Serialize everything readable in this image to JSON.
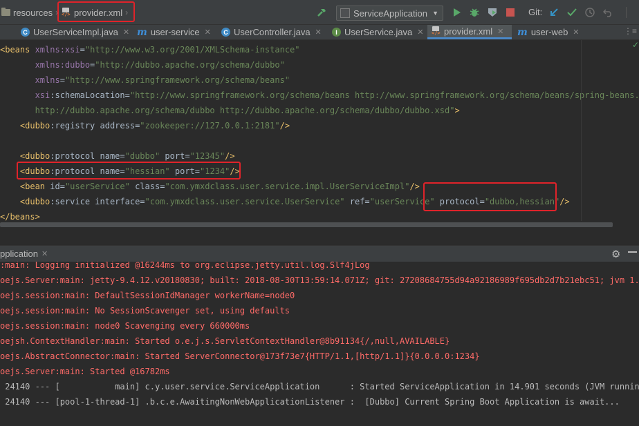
{
  "navbar": {
    "breadcrumbs": [
      {
        "label": "resources",
        "icon": "folder-icon"
      },
      {
        "label": "provider.xml",
        "icon": "xml-file-icon"
      }
    ],
    "run_config": "ServiceApplication",
    "vcs_label": "Git:",
    "icons": [
      "build-hammer-icon",
      "run-icon",
      "debug-icon",
      "coverage-icon",
      "stop-icon",
      "vcs-update-icon",
      "vcs-commit-icon",
      "vcs-history-icon",
      "vcs-revert-icon"
    ]
  },
  "tabs": [
    {
      "label": "UserServiceImpl.java",
      "icon": "class-icon",
      "icon_letter": "C"
    },
    {
      "label": "user-service",
      "icon": "maven-module-icon",
      "icon_letter": "m"
    },
    {
      "label": "UserController.java",
      "icon": "class-icon",
      "icon_letter": "C"
    },
    {
      "label": "UserService.java",
      "icon": "interface-icon",
      "icon_letter": "I"
    },
    {
      "label": "provider.xml",
      "icon": "xml-file-icon",
      "active": true
    },
    {
      "label": "user-web",
      "icon": "maven-module-icon",
      "icon_letter": "m"
    }
  ],
  "editor": {
    "lines": [
      [
        [
          "tag",
          "<beans "
        ],
        [
          "ns",
          "xmlns:xsi"
        ],
        [
          "plain",
          "="
        ],
        [
          "val",
          "\"http://www.w3.org/2001/XMLSchema-instance\""
        ]
      ],
      [
        [
          "ns",
          "       xmlns:dubbo"
        ],
        [
          "plain",
          "="
        ],
        [
          "val",
          "\"http://dubbo.apache.org/schema/dubbo\""
        ]
      ],
      [
        [
          "ns",
          "       xmlns"
        ],
        [
          "plain",
          "="
        ],
        [
          "val",
          "\"http://www.springframework.org/schema/beans\""
        ]
      ],
      [
        [
          "ns",
          "       xsi"
        ],
        [
          "plain",
          ":schemaLocation="
        ],
        [
          "val",
          "\"http://www.springframework.org/schema/beans http://www.springframework.org/schema/beans/spring-beans.xsd"
        ]
      ],
      [
        [
          "val",
          "       http://dubbo.apache.org/schema/dubbo http://dubbo.apache.org/schema/dubbo/dubbo.xsd\""
        ],
        [
          "tag",
          ">"
        ]
      ],
      [
        [
          "tag",
          "    <dubbo"
        ],
        [
          "plain",
          ":registry address="
        ],
        [
          "val",
          "\"zookeeper://127.0.0.1:2181\""
        ],
        [
          "tag",
          "/>"
        ]
      ],
      [],
      [
        [
          "tag",
          "    <dubbo"
        ],
        [
          "plain",
          ":protocol name="
        ],
        [
          "val",
          "\"dubbo\""
        ],
        [
          "plain",
          " port="
        ],
        [
          "val",
          "\"12345\""
        ],
        [
          "tag",
          "/>"
        ]
      ],
      [
        [
          "tag",
          "    <dubbo"
        ],
        [
          "plain",
          ":protocol name="
        ],
        [
          "val",
          "\"hessian\""
        ],
        [
          "plain",
          " port="
        ],
        [
          "val",
          "\"1234\""
        ],
        [
          "tag",
          "/>"
        ]
      ],
      [
        [
          "tag",
          "    <bean "
        ],
        [
          "plain",
          "id="
        ],
        [
          "val",
          "\"userService\""
        ],
        [
          "plain",
          " class="
        ],
        [
          "val",
          "\"com.ymxdclass.user.service.impl.UserServiceImpl\""
        ],
        [
          "tag",
          "/>"
        ]
      ],
      [
        [
          "tag",
          "    <dubbo"
        ],
        [
          "plain",
          ":service interface="
        ],
        [
          "val",
          "\"com.ymxdclass.user.service.UserService\""
        ],
        [
          "plain",
          " ref="
        ],
        [
          "val",
          "\"userService\""
        ],
        [
          "plain",
          " protocol="
        ],
        [
          "val",
          "\"dubbo,hessian\""
        ],
        [
          "tag",
          "/>"
        ]
      ],
      [
        [
          "tag",
          "</beans>"
        ]
      ]
    ]
  },
  "run_panel": {
    "title": "pplication",
    "settings_icon": "gear-icon",
    "log_lines": [
      {
        "color": "red",
        "text": ":main: Logging initialized @16244ms to org.eclipse.jetty.util.log.Slf4jLog"
      },
      {
        "color": "red",
        "text": "oejs.Server:main: jetty-9.4.12.v20180830; built: 2018-08-30T13:59:14.071Z; git: 27208684755d94a92186989f695db2d7b21ebc51; jvm 1.8.0_"
      },
      {
        "color": "red",
        "text": "oejs.session:main: DefaultSessionIdManager workerName=node0"
      },
      {
        "color": "red",
        "text": "oejs.session:main: No SessionScavenger set, using defaults"
      },
      {
        "color": "red",
        "text": "oejs.session:main: node0 Scavenging every 660000ms"
      },
      {
        "color": "red",
        "text": "oejsh.ContextHandler:main: Started o.e.j.s.ServletContextHandler@8b91134{/,null,AVAILABLE}"
      },
      {
        "color": "red",
        "text": "oejs.AbstractConnector:main: Started ServerConnector@173f73e7{HTTP/1.1,[http/1.1]}{0.0.0.0:1234}"
      },
      {
        "color": "red",
        "text": "oejs.Server:main: Started @16782ms"
      },
      {
        "color": "grey",
        "text": " 24140 --- [           main] c.y.user.service.ServiceApplication      : Started ServiceApplication in 14.901 seconds (JVM running fo"
      },
      {
        "color": "grey",
        "text": " 24140 --- [pool-1-thread-1] .b.c.e.AwaitingNonWebApplicationListener :  [Dubbo] Current Spring Boot Application is await..."
      }
    ]
  }
}
